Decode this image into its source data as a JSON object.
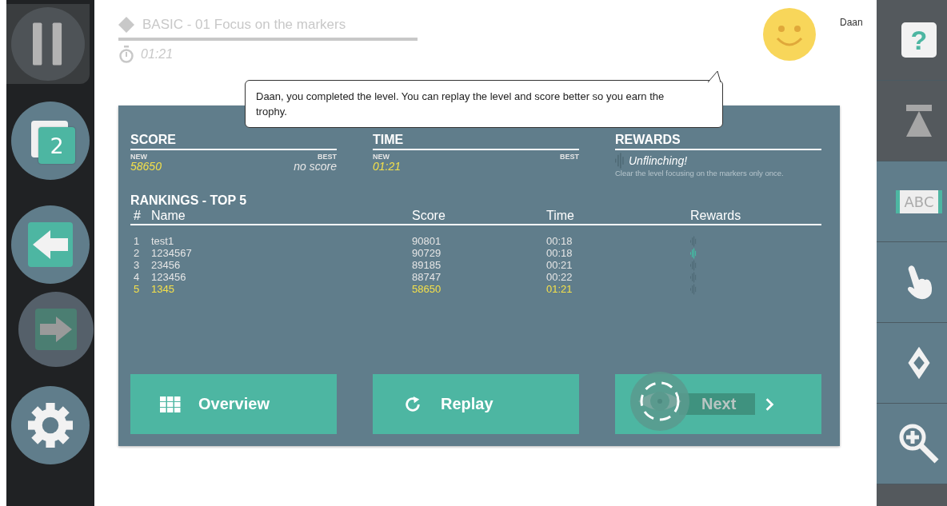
{
  "left_toolbar": {
    "pages_badge": "2",
    "back_enabled": true,
    "forward_enabled": false
  },
  "level": {
    "title": "BASIC - 01 Focus on the markers",
    "timer": "01:21"
  },
  "user": {
    "name": "Daan"
  },
  "message": "Daan, you completed the level. You can replay the level and score better so you earn the trophy.",
  "score": {
    "heading": "SCORE",
    "new_label": "NEW",
    "new_value": "58650",
    "best_label": "BEST",
    "best_value": "no score"
  },
  "time": {
    "heading": "TIME",
    "new_label": "NEW",
    "new_value": "01:21",
    "best_label": "BEST"
  },
  "rewards": {
    "heading": "REWARDS",
    "name": "Unflinching!",
    "description": "Clear the level focusing on the markers only once.",
    "earned": false
  },
  "rankings": {
    "title": "RANKINGS - TOP 5",
    "columns": [
      "#",
      "Name",
      "Score",
      "Time",
      "Rewards"
    ],
    "rows": [
      {
        "rank": "1",
        "name": "test1",
        "score": "90801",
        "time": "00:18",
        "reward_earned": false,
        "current": false
      },
      {
        "rank": "2",
        "name": "1234567",
        "score": "90729",
        "time": "00:18",
        "reward_earned": true,
        "current": false
      },
      {
        "rank": "3",
        "name": "23456",
        "score": "89185",
        "time": "00:21",
        "reward_earned": false,
        "current": false
      },
      {
        "rank": "4",
        "name": "123456",
        "score": "88747",
        "time": "00:22",
        "reward_earned": false,
        "current": false
      },
      {
        "rank": "5",
        "name": "1345",
        "score": "58650",
        "time": "01:21",
        "reward_earned": false,
        "current": true
      }
    ]
  },
  "actions": [
    {
      "kind": "overview",
      "label": "Overview"
    },
    {
      "kind": "replay",
      "label": "Replay"
    },
    {
      "kind": "next",
      "label": "Next"
    }
  ],
  "right_toolbar": [
    {
      "kind": "help",
      "label": "?"
    },
    {
      "kind": "weight",
      "disabled": true
    },
    {
      "kind": "text",
      "label": "ABC",
      "disabled": false
    },
    {
      "kind": "hand",
      "disabled": false
    },
    {
      "kind": "marker",
      "disabled": false
    },
    {
      "kind": "zoom",
      "disabled": false
    }
  ]
}
